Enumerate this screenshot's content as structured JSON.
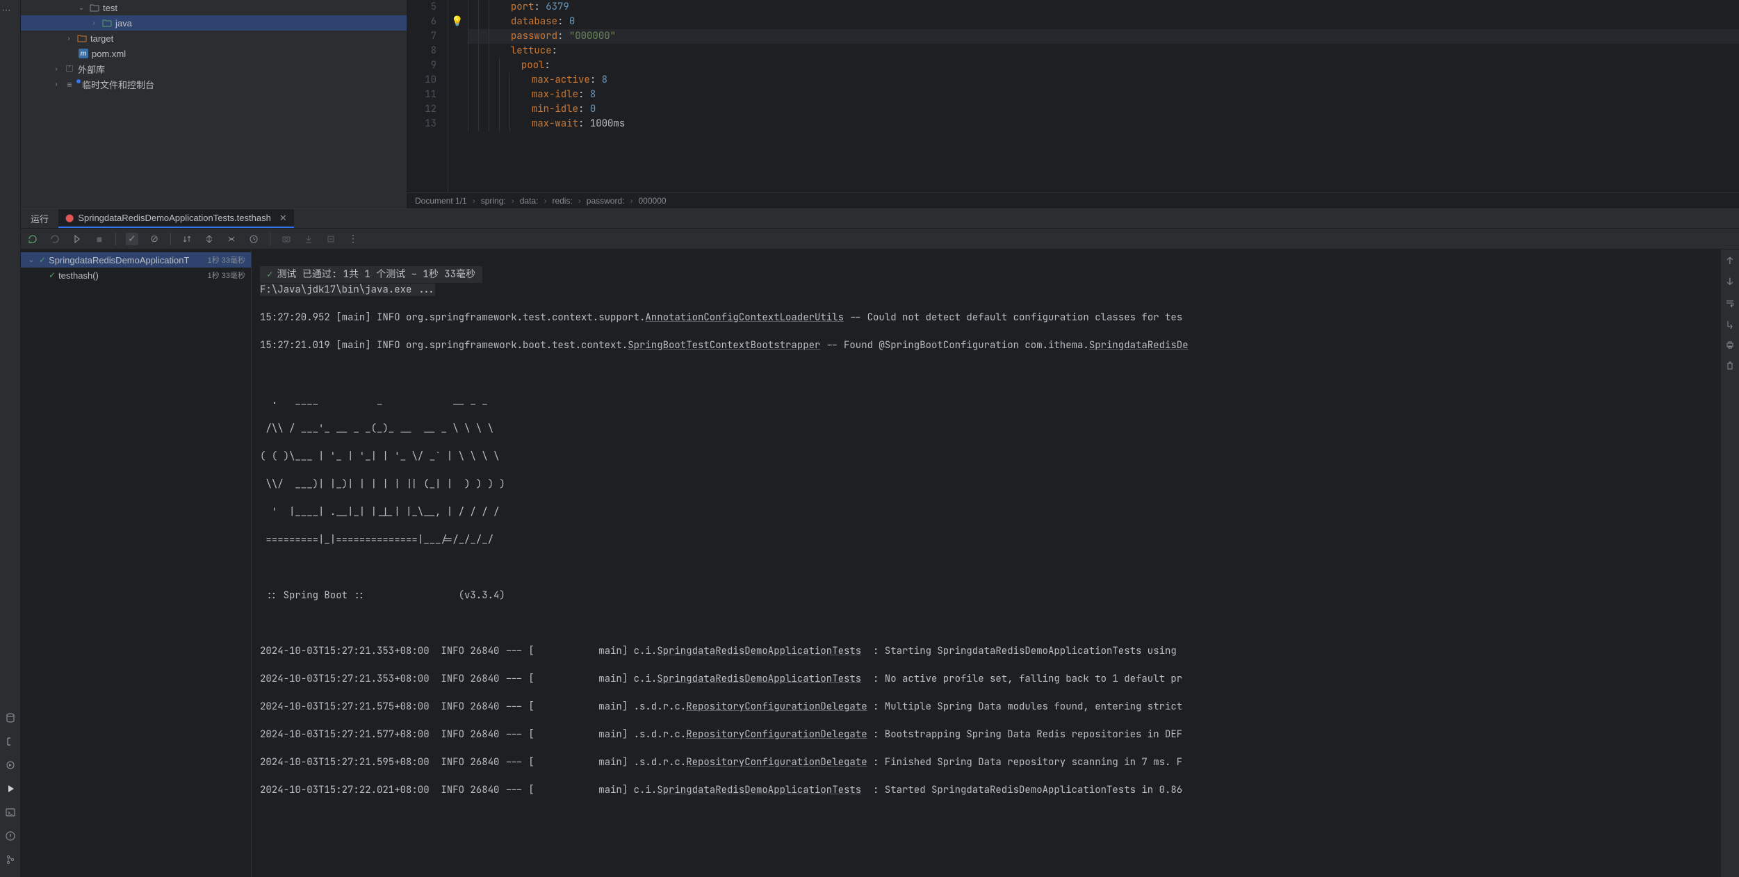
{
  "tree": {
    "test_folder": "test",
    "java_folder": "java",
    "target_folder": "target",
    "pom_file": "pom.xml",
    "external_libs": "外部库",
    "scratch": "临时文件和控制台"
  },
  "editor": {
    "lines": {
      "5": {
        "indent": 3,
        "key": "port",
        "val": "6379",
        "type": "num"
      },
      "6": {
        "indent": 3,
        "key": "database",
        "val": "0",
        "type": "num"
      },
      "7": {
        "indent": 3,
        "key": "password",
        "val": "\"000000\"",
        "type": "str"
      },
      "8": {
        "indent": 3,
        "key": "lettuce",
        "val": "",
        "type": "none"
      },
      "9": {
        "indent": 4,
        "key": "pool",
        "val": "",
        "type": "none"
      },
      "10": {
        "indent": 5,
        "key": "max-active",
        "val": "8",
        "type": "num"
      },
      "11": {
        "indent": 5,
        "key": "max-idle",
        "val": "8",
        "type": "num"
      },
      "12": {
        "indent": 5,
        "key": "min-idle",
        "val": "0",
        "type": "num"
      },
      "13": {
        "indent": 5,
        "key": "max-wait",
        "val": "1000ms",
        "type": "plain"
      }
    }
  },
  "breadcrumb": {
    "doc": "Document 1/1",
    "p1": "spring:",
    "p2": "data:",
    "p3": "redis:",
    "p4": "password:",
    "val": "000000"
  },
  "run": {
    "tab_label": "运行",
    "active_tab": "SpringdataRedisDemoApplicationTests.testhash",
    "status": "测试 已通过: 1共 1 个测试 – 1秒 33毫秒",
    "test_class": "SpringdataRedisDemoApplicationT",
    "test_class_time": "1秒 33毫秒",
    "test_method": "testhash()",
    "test_method_time": "1秒 33毫秒"
  },
  "console": {
    "cmd": "F:\\Java\\jdk17\\bin\\java.exe ...",
    "l1a": "15:27:20.952 [main] INFO org.springframework.test.context.support.",
    "l1link": "AnnotationConfigContextLoaderUtils",
    "l1b": " -- Could not detect default configuration classes for tes",
    "l2a": "15:27:21.019 [main] INFO org.springframework.boot.test.context.",
    "l2link": "SpringBootTestContextBootstrapper",
    "l2b": " -- Found @SpringBootConfiguration com.ithema.",
    "l2link2": "SpringdataRedisDe",
    "banner1": "  .   ____          _            __ _ _",
    "banner2": " /\\\\ / ___'_ __ _ _(_)_ __  __ _ \\ \\ \\ \\",
    "banner3": "( ( )\\___ | '_ | '_| | '_ \\/ _` | \\ \\ \\ \\",
    "banner4": " \\\\/  ___)| |_)| | | | | || (_| |  ) ) ) )",
    "banner5": "  '  |____| .__|_| |_|_| |_\\__, | / / / /",
    "banner6": " =========|_|==============|___/=/_/_/_/",
    "banner8": " :: Spring Boot ::                (v3.3.4)",
    "log1a": "2024-10-03T15:27:21.353+08:00  INFO 26840 --- [           main] c.i.",
    "log1link": "SpringdataRedisDemoApplicationTests",
    "log1b": "  : Starting SpringdataRedisDemoApplicationTests using ",
    "log2a": "2024-10-03T15:27:21.353+08:00  INFO 26840 --- [           main] c.i.",
    "log2link": "SpringdataRedisDemoApplicationTests",
    "log2b": "  : No active profile set, falling back to 1 default pr",
    "log3a": "2024-10-03T15:27:21.575+08:00  INFO 26840 --- [           main] .s.d.r.c.",
    "log3link": "RepositoryConfigurationDelegate",
    "log3b": " : Multiple Spring Data modules found, entering strict",
    "log4a": "2024-10-03T15:27:21.577+08:00  INFO 26840 --- [           main] .s.d.r.c.",
    "log4link": "RepositoryConfigurationDelegate",
    "log4b": " : Bootstrapping Spring Data Redis repositories in DEF",
    "log5a": "2024-10-03T15:27:21.595+08:00  INFO 26840 --- [           main] .s.d.r.c.",
    "log5link": "RepositoryConfigurationDelegate",
    "log5b": " : Finished Spring Data repository scanning in 7 ms. F",
    "log6a": "2024-10-03T15:27:22.021+08:00  INFO 26840 --- [           main] c.i.",
    "log6link": "SpringdataRedisDemoApplicationTests",
    "log6b": "  : Started SpringdataRedisDemoApplicationTests in 0.86"
  }
}
